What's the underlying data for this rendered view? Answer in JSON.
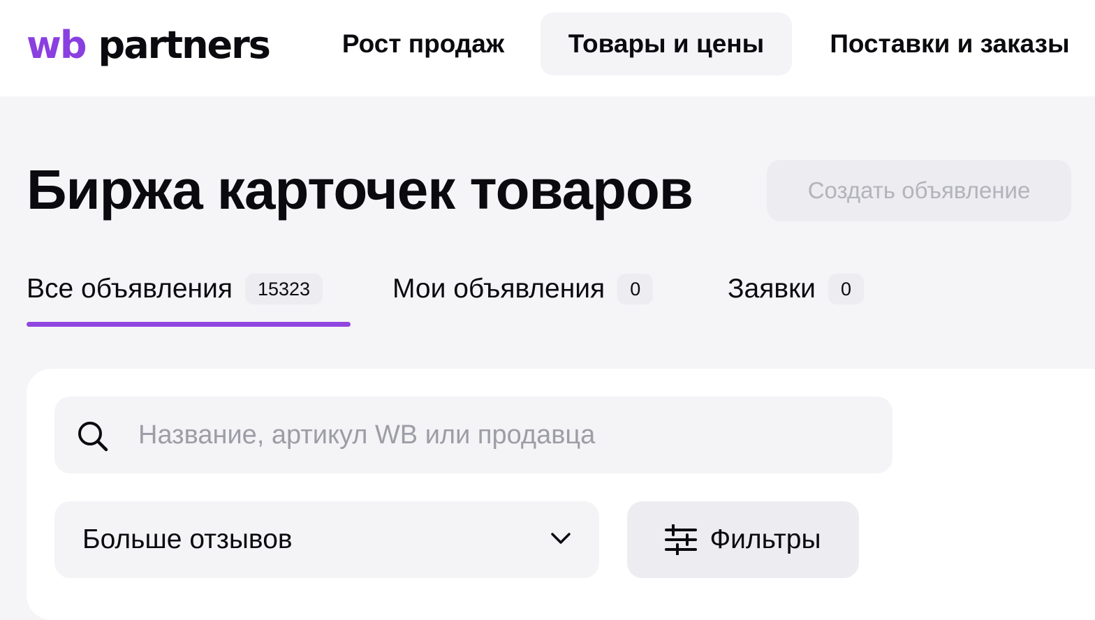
{
  "logo": {
    "wb": "wb",
    "partners": "partners"
  },
  "nav": {
    "items": [
      {
        "label": "Рост продаж"
      },
      {
        "label": "Товары и цены",
        "active": true
      },
      {
        "label": "Поставки и заказы"
      }
    ]
  },
  "page": {
    "title": "Биржа карточек товаров"
  },
  "actions": {
    "create_label": "Создать объявление"
  },
  "tabs": [
    {
      "label": "Все объявления",
      "count": "15323",
      "active": true
    },
    {
      "label": "Мои объявления",
      "count": "0"
    },
    {
      "label": "Заявки",
      "count": "0"
    }
  ],
  "search": {
    "placeholder": "Название, артикул WB или продавца",
    "value": ""
  },
  "sort": {
    "selected": "Больше отзывов"
  },
  "filters": {
    "label": "Фильтры"
  },
  "colors": {
    "accent": "#9145e0",
    "brand": "#8a3fe0"
  },
  "icons": {
    "search": "search-icon",
    "sort": "chevron-down-icon",
    "filters": "sliders-icon"
  }
}
